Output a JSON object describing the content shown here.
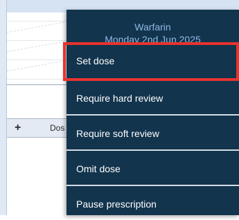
{
  "background": {
    "toolbar": {
      "add_label": "+",
      "column_label": "Dos"
    }
  },
  "context_menu": {
    "title": "Warfarin",
    "subtitle": "Monday 2nd Jun 2025",
    "items": [
      {
        "label": "Set dose",
        "highlighted": true
      },
      {
        "label": "Require hard review"
      },
      {
        "label": "Require soft review"
      },
      {
        "label": "Omit dose"
      },
      {
        "label": "Pause prescription"
      }
    ]
  },
  "colors": {
    "menu_background": "#12344d",
    "menu_header_text": "#8fb8e3",
    "highlight_border": "#e8332e"
  }
}
